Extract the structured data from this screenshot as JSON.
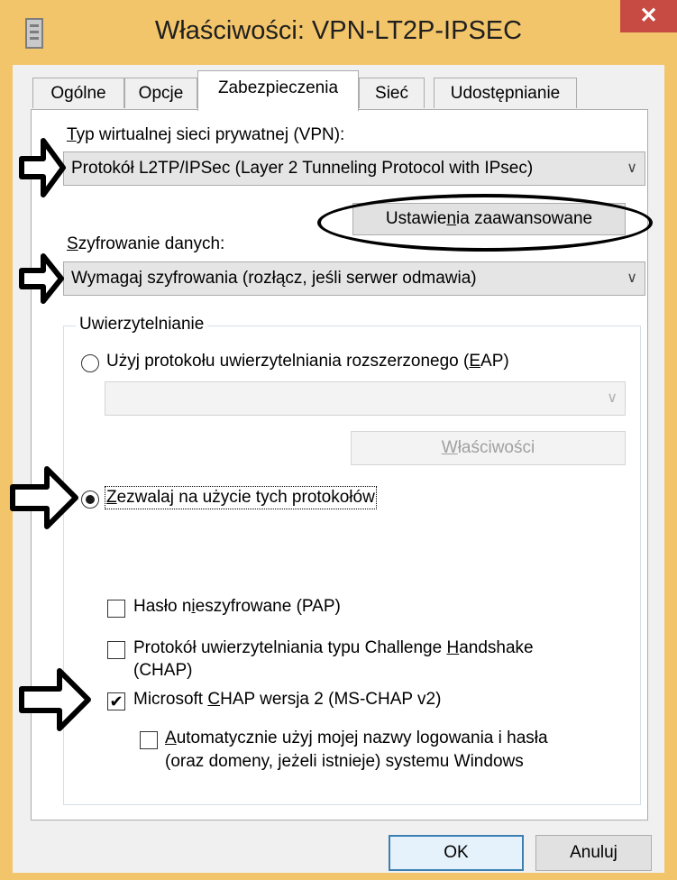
{
  "window": {
    "title": "Właściwości: VPN-LT2P-IPSEC",
    "close_glyph": "✕",
    "icon": "document-icon"
  },
  "tabs": [
    {
      "label": "Ogólne",
      "active": false
    },
    {
      "label": "Opcje",
      "active": false
    },
    {
      "label": "Zabezpieczenia",
      "active": true
    },
    {
      "label": "Sieć",
      "active": false
    },
    {
      "label": "Udostępnianie",
      "active": false
    }
  ],
  "vpn_type": {
    "label_prefix": "T",
    "label_rest": "yp wirtualnej sieci prywatnej (VPN):",
    "selected": "Protokół L2TP/IPSec (Layer 2 Tunneling Protocol with IPsec)"
  },
  "advanced_button": {
    "pre": "Ustawie",
    "accel": "n",
    "post": "ia zaawansowane"
  },
  "encryption": {
    "label_prefix": "S",
    "label_rest": "zyfrowanie danych:",
    "selected": "Wymagaj szyfrowania (rozłącz, jeśli serwer odmawia)"
  },
  "authentication": {
    "group_label": "Uwierzytelnianie",
    "eap_radio": {
      "pre": "Użyj protokołu uwierzytelniania rozszerzonego (",
      "accel": "E",
      "post": "AP)",
      "checked": false
    },
    "eap_combo_value": "",
    "eap_properties": {
      "accel": "W",
      "rest": "łaściwości",
      "enabled": false
    },
    "protocols_radio": {
      "accel": "Z",
      "rest": "ezwalaj na użycie tych protokołów",
      "checked": true
    },
    "pap": {
      "pre": "Hasło n",
      "accel": "i",
      "post": "eszyfrowane (PAP)",
      "checked": false
    },
    "chap": {
      "line1_pre": "Protokół uwierzytelniania typu Challenge ",
      "accel": "H",
      "line1_post": "andshake",
      "line2": "(CHAP)",
      "checked": false
    },
    "mschap": {
      "pre": "Microsoft ",
      "accel": "C",
      "post": "HAP wersja 2 (MS-CHAP v2)",
      "checked": true
    },
    "auto_login": {
      "accel": "A",
      "line1_rest": "utomatycznie użyj mojej nazwy logowania i hasła",
      "line2": "(oraz domeny, jeżeli istnieje) systemu Windows",
      "checked": false
    }
  },
  "footer": {
    "ok": "OK",
    "cancel": "Anuluj"
  },
  "glyphs": {
    "dropdown_arrow": "∨",
    "checkmark": "✔"
  },
  "colors": {
    "window_frame": "#f2c56a",
    "close_button": "#c74a43",
    "panel": "#ffffff",
    "dialog_bg": "#f0f0f0"
  },
  "annotations": {
    "arrow_count": 4,
    "oval_count": 1
  }
}
